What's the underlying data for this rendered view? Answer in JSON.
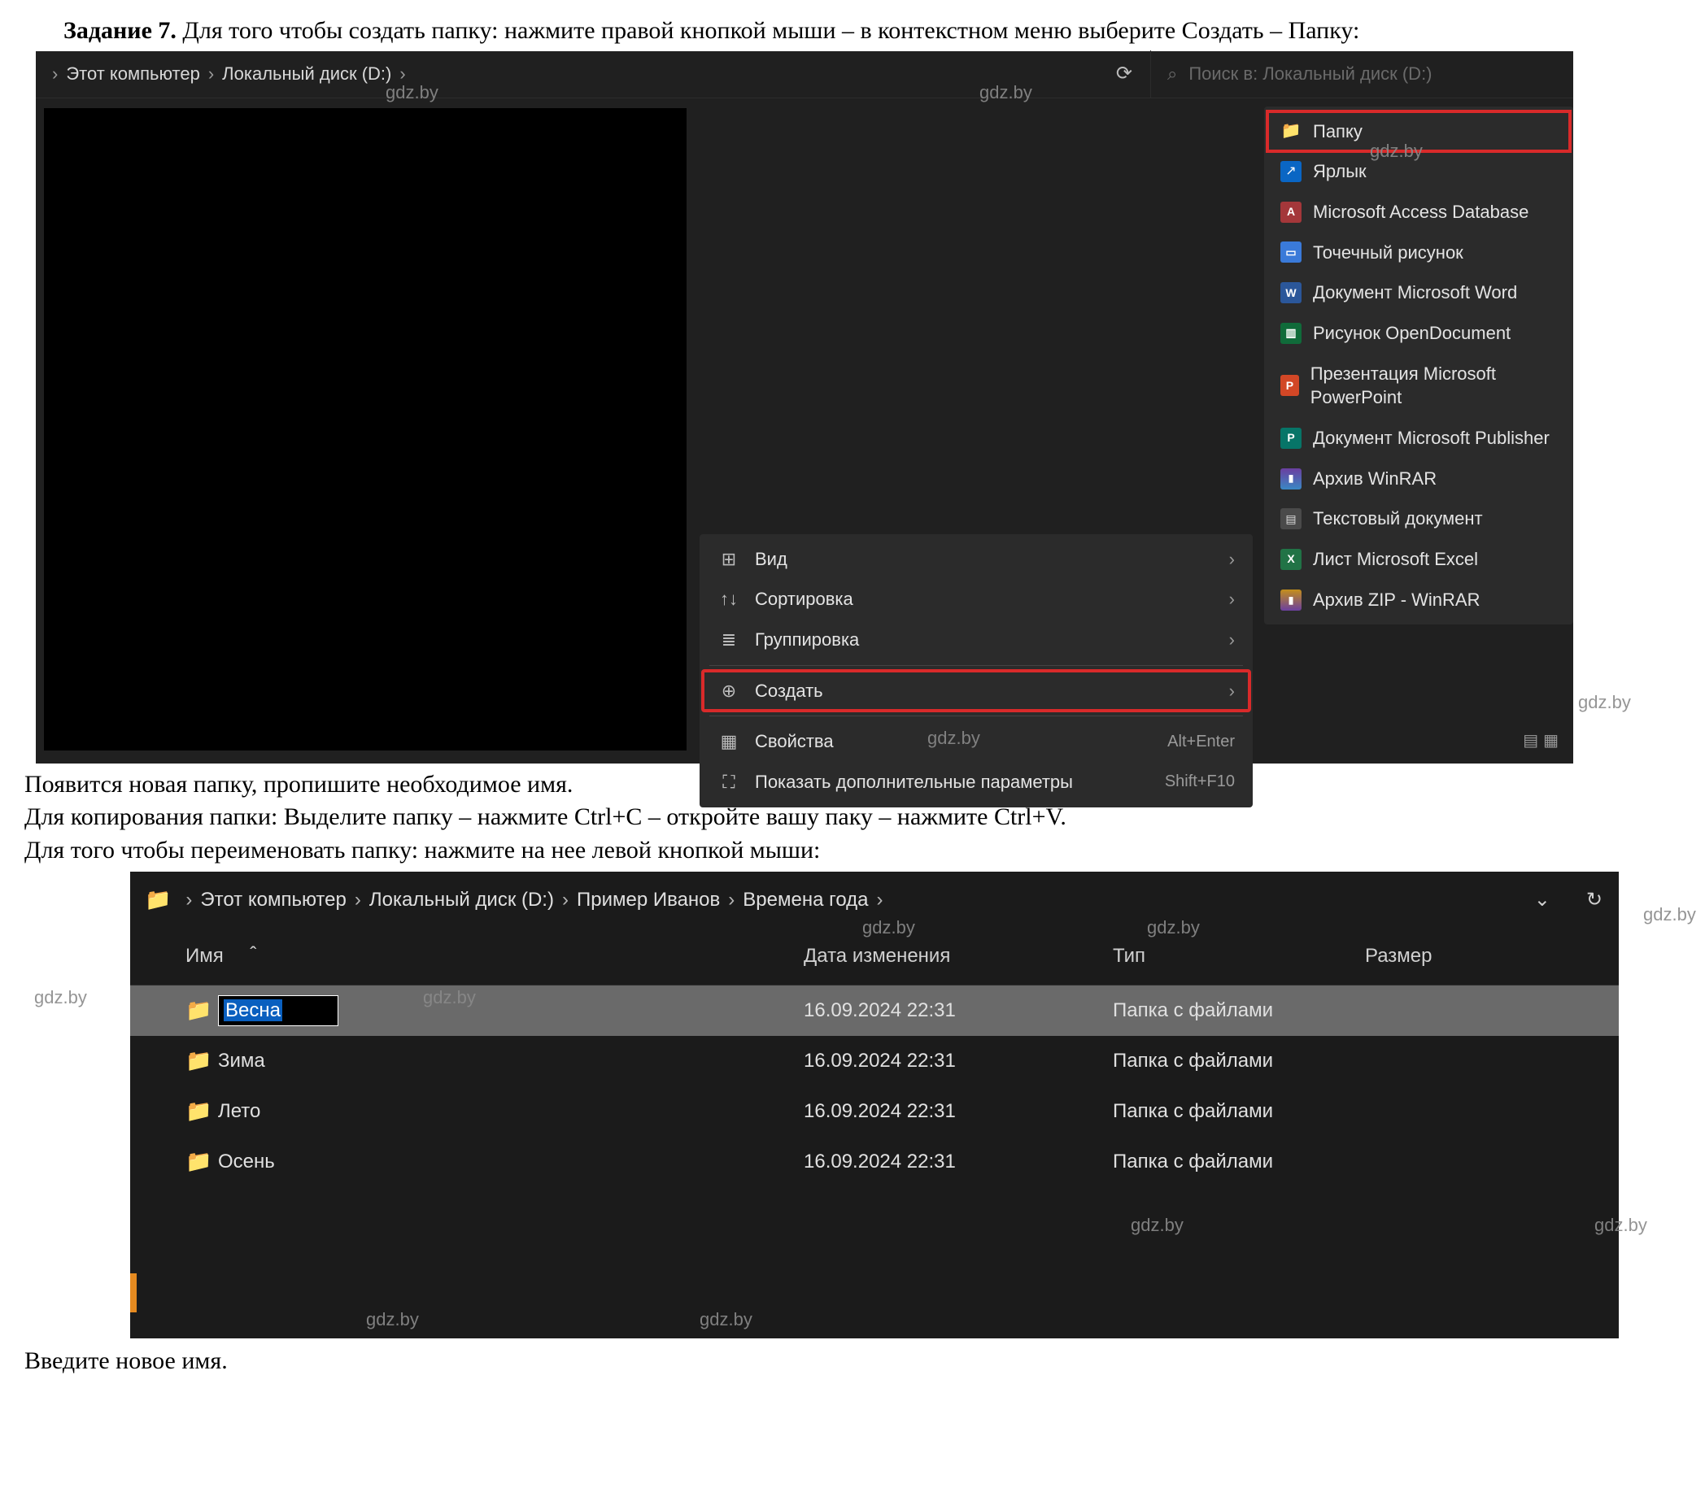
{
  "task": {
    "label": "Задание 7.",
    "text_first": "Для того чтобы создать папку: нажмите правой кнопкой мыши – в контекстном меню выберите Создать – Папку:"
  },
  "screenshot1": {
    "breadcrumb": {
      "segments": [
        "Этот компьютер",
        "Локальный диск (D:)"
      ]
    },
    "search_placeholder": "Поиск в: Локальный диск (D:)",
    "context_menu": {
      "items": [
        {
          "id": "view",
          "label": "Вид",
          "icon": "⊞",
          "submenu": true,
          "highlight": false
        },
        {
          "id": "sort",
          "label": "Сортировка",
          "icon": "↑↓",
          "submenu": true,
          "highlight": false
        },
        {
          "id": "group",
          "label": "Группировка",
          "icon": "≣",
          "submenu": true,
          "highlight": false
        },
        {
          "divider": true
        },
        {
          "id": "new",
          "label": "Создать",
          "icon": "⊕",
          "submenu": true,
          "highlight": true
        },
        {
          "divider": true
        },
        {
          "id": "props",
          "label": "Свойства",
          "icon": "▦",
          "shortcut": "Alt+Enter",
          "highlight": false
        },
        {
          "id": "more",
          "label": "Показать дополнительные параметры",
          "icon": "⛶",
          "shortcut": "Shift+F10",
          "highlight": false
        }
      ],
      "submenu_new": [
        {
          "id": "folder",
          "label": "Папку",
          "icon_class": "fi-folder",
          "glyph": "📁",
          "highlight": true
        },
        {
          "id": "shortcut",
          "label": "Ярлык",
          "icon_class": "fi-shortcut",
          "glyph": "↗"
        },
        {
          "id": "access",
          "label": "Microsoft Access Database",
          "icon_class": "fi-access",
          "glyph": "A"
        },
        {
          "id": "bitmap",
          "label": "Точечный рисунок",
          "icon_class": "fi-bmp",
          "glyph": "▭"
        },
        {
          "id": "word",
          "label": "Документ Microsoft Word",
          "icon_class": "fi-word",
          "glyph": "W"
        },
        {
          "id": "odg",
          "label": "Рисунок OpenDocument",
          "icon_class": "fi-odg",
          "glyph": "▥"
        },
        {
          "id": "ppt",
          "label": "Презентация Microsoft PowerPoint",
          "icon_class": "fi-ppt",
          "glyph": "P"
        },
        {
          "id": "pub",
          "label": "Документ Microsoft Publisher",
          "icon_class": "fi-pub",
          "glyph": "P"
        },
        {
          "id": "rar",
          "label": "Архив WinRAR",
          "icon_class": "fi-rar",
          "glyph": "▮"
        },
        {
          "id": "txt",
          "label": "Текстовый документ",
          "icon_class": "fi-txt",
          "glyph": "▤"
        },
        {
          "id": "xls",
          "label": "Лист Microsoft Excel",
          "icon_class": "fi-xls",
          "glyph": "X"
        },
        {
          "id": "zip",
          "label": "Архив ZIP - WinRAR",
          "icon_class": "fi-zip",
          "glyph": "▮"
        }
      ]
    }
  },
  "mid_text": {
    "line1": "Появится новая папку, пропишите необходимое имя.",
    "line2": "Для копирования папки: Выделите папку – нажмите Ctrl+C – откройте вашу паку – нажмите Ctrl+V.",
    "line3": "Для того чтобы переименовать папку: нажмите на нее левой кнопкой мыши:"
  },
  "screenshot2": {
    "breadcrumb": {
      "segments": [
        "Этот компьютер",
        "Локальный диск (D:)",
        "Пример Иванов",
        "Времена года"
      ]
    },
    "columns": {
      "name": "Имя",
      "date": "Дата изменения",
      "type": "Тип",
      "size": "Размер"
    },
    "rows": [
      {
        "name": "Весна",
        "date": "16.09.2024 22:31",
        "type": "Папка с файлами",
        "selected": true,
        "editing": true
      },
      {
        "name": "Зима",
        "date": "16.09.2024 22:31",
        "type": "Папка с файлами",
        "selected": false
      },
      {
        "name": "Лето",
        "date": "16.09.2024 22:31",
        "type": "Папка с файлами",
        "selected": false
      },
      {
        "name": "Осень",
        "date": "16.09.2024 22:31",
        "type": "Папка с файлами",
        "selected": false
      }
    ]
  },
  "end_text": "Введите новое имя.",
  "watermark": "gdz.by"
}
